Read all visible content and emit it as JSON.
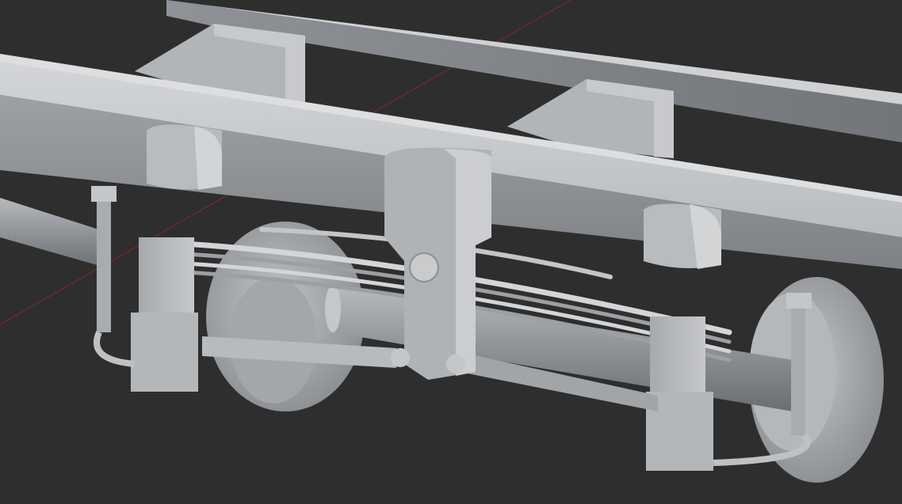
{
  "viewport": {
    "background": "#2e2e2e",
    "grid_axis_color": "#8a2a2a",
    "model_colors": {
      "light": "#c9cbcd",
      "mid": "#a3a6a9",
      "dark": "#7d8084",
      "shadow": "#5c5f63"
    }
  },
  "scene": {
    "objects": [
      "chassis-frame",
      "frame-crossmember",
      "leaf-spring",
      "axle",
      "wheel",
      "shock-absorber",
      "spring-hanger"
    ]
  }
}
